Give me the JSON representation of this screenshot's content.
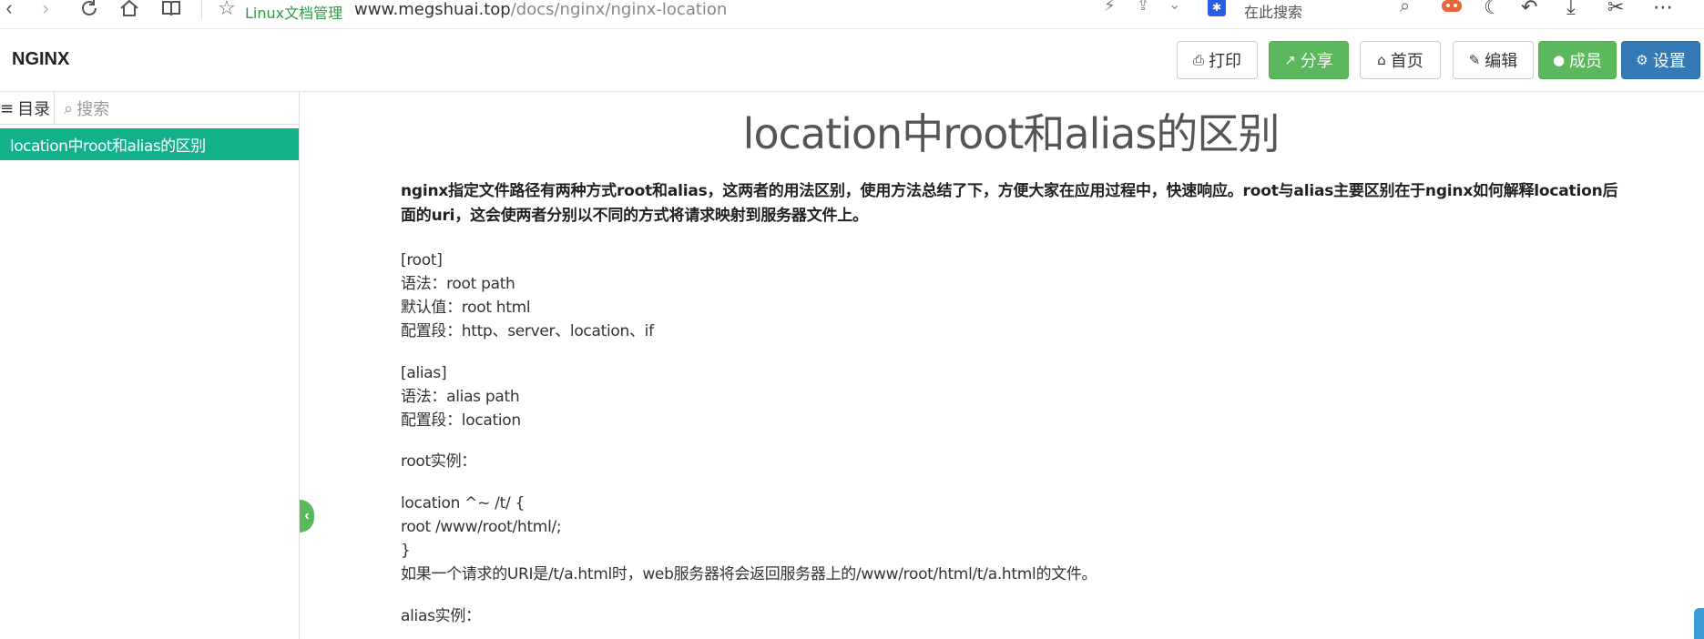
{
  "browser": {
    "site_name": "Linux文档管理",
    "url_host": "www.megshuai.top",
    "url_path": "/docs/nginx/nginx-location",
    "search_placeholder": "在此搜索"
  },
  "header": {
    "brand": "NGINX",
    "buttons": {
      "print": "打印",
      "share": "分享",
      "home": "首页",
      "edit": "编辑",
      "members": "成员",
      "settings": "设置"
    }
  },
  "sidebar": {
    "tab_toc": "目录",
    "tab_search": "搜索",
    "items": [
      {
        "label": "location中root和alias的区别",
        "active": true
      }
    ]
  },
  "article": {
    "title": "location中root和alias的区别",
    "lead": "nginx指定文件路径有两种方式root和alias，这两者的用法区别，使用方法总结了下，方便大家在应用过程中，快速响应。root与alias主要区别在于nginx如何解释location后面的uri，这会使两者分别以不同的方式将请求映射到服务器文件上。",
    "root_block": [
      "[root]",
      "语法：root path",
      "默认值：root html",
      "配置段：http、server、location、if"
    ],
    "alias_block": [
      "[alias]",
      "语法：alias path",
      "配置段：location"
    ],
    "root_example_heading": "root实例：",
    "root_example_code": [
      "location ^~ /t/ {",
      "root /www/root/html/;",
      "}"
    ],
    "root_example_note": "如果一个请求的URI是/t/a.html时，web服务器将会返回服务器上的/www/root/html/t/a.html的文件。",
    "alias_example_heading": "alias实例："
  },
  "colors": {
    "active_item": "#13b18b",
    "success": "#5cb85c",
    "primary": "#337ab7"
  }
}
